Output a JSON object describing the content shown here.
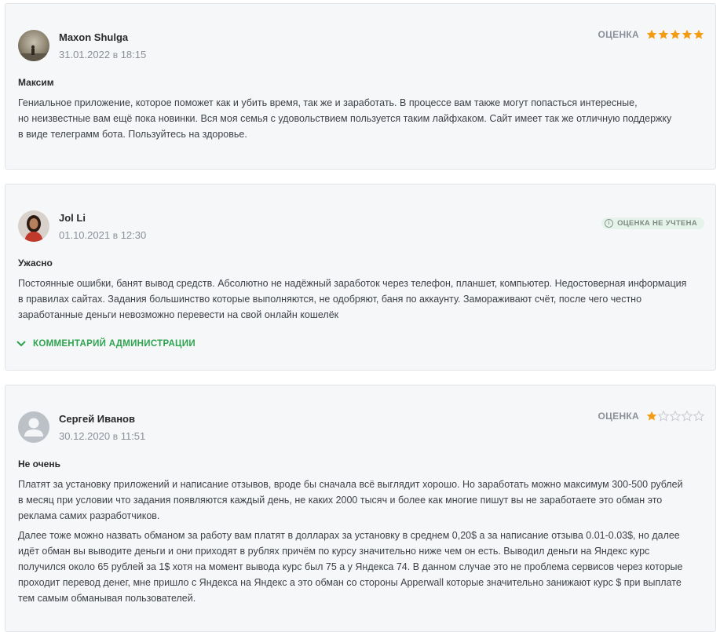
{
  "colors": {
    "star_filled": "#f39c12",
    "star_empty": "#c7cbd1",
    "accent_green": "#2ea44f",
    "card_bg": "#f6f7f9"
  },
  "reviews": [
    {
      "author": "Maxon Shulga",
      "date": "31.01.2022",
      "time_sep": "в",
      "time": "18:15",
      "rating_label": "ОЦЕНКА",
      "rating": 5,
      "title": "Максим",
      "paragraphs": [
        "Гениальное приложение, которое поможет как и убить время, так же и заработать. В процессе вам также могут попасться интересные,\nно неизвестные вам ещё пока новинки. Вся моя семья с удовольствием пользуется таким лайфхаком. Сайт имеет так же отличную поддержку\nв виде телеграмм бота. Пользуйтесь на здоровье."
      ]
    },
    {
      "author": "Jol Li",
      "date": "01.10.2021",
      "time_sep": "в",
      "time": "12:30",
      "badge_icon": "info-icon",
      "badge_label": "ОЦЕНКА НЕ УЧТЕНА",
      "title": "Ужасно",
      "paragraphs": [
        "Постоянные ошибки, банят вывод средств. Абсолютно не надёжный заработок через телефон, планшет, компьютер. Недостоверная информация\nв правилах сайтах. Задания большинство которые выполняются, не одобряют, баня по аккаунту. Замораживают счёт, после чего честно\nзаработанные деньги невозможно перевести на свой онлайн кошелёк"
      ],
      "admin_comment_label": "КОММЕНТАРИЙ АДМИНИСТРАЦИИ"
    },
    {
      "author": "Сергей Иванов",
      "date": "30.12.2020",
      "time_sep": "в",
      "time": "11:51",
      "rating_label": "ОЦЕНКА",
      "rating": 1,
      "title": "Не очень",
      "paragraphs": [
        "Платят за установку приложений и написание отзывов, вроде бы сначала всё выглядит хорошо. Но заработать можно максимум 300-500 рублей\nв месяц при условии что задания появляются каждый день, не каких 2000 тысяч и более как многие пишут вы не заработаете это обман это\nреклама самих разработчиков.",
        "Далее тоже можно назвать обманом за работу вам платят в долларах за установку в среднем 0,20$ а за написание отзыва 0.01-0.03$, но далее\nидёт обман вы выводите деньги и они приходят в рублях причём по курсу значительно ниже чем он есть. Выводил деньги на Яндекс курс\nполучился около 65 рублей за 1$ хотя на момент вывода курс был 75 а у Яндекса 74. В данном случае это не проблема сервисов через которые\nпроходит перевод денег, мне пришло с Яндекса на Яндекс а это обман со стороны Apperwall которые значительно занижают курс $ при выплате\nтем самым обманывая пользователей."
      ]
    }
  ]
}
